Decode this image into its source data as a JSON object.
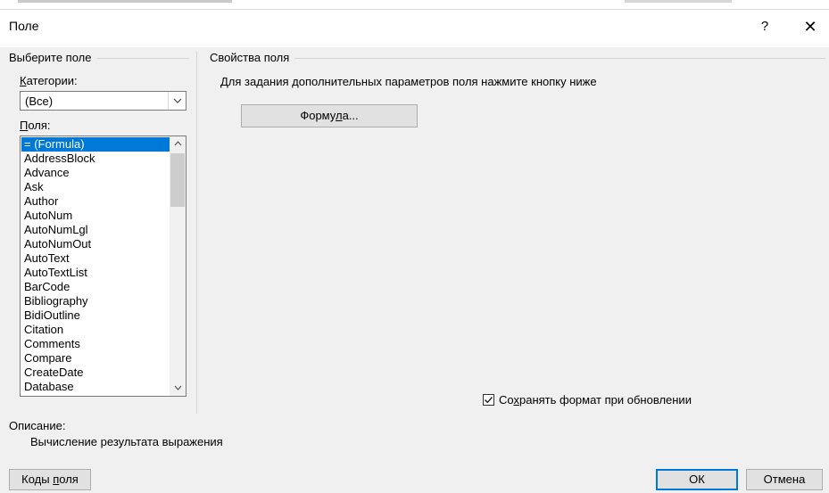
{
  "window": {
    "title": "Поле",
    "help_label": "?",
    "close_label": "✕"
  },
  "left_group": {
    "label": "Выберите поле",
    "categories": {
      "label_prefix": "К",
      "label_rest": "атегории:",
      "selected": "(Все)"
    },
    "fields": {
      "label_prefix": "П",
      "label_rest": "оля:",
      "items": [
        {
          "label": "= (Formula)",
          "selected": true
        },
        {
          "label": "AddressBlock"
        },
        {
          "label": "Advance"
        },
        {
          "label": "Ask"
        },
        {
          "label": "Author"
        },
        {
          "label": "AutoNum"
        },
        {
          "label": "AutoNumLgl"
        },
        {
          "label": "AutoNumOut"
        },
        {
          "label": "AutoText"
        },
        {
          "label": "AutoTextList"
        },
        {
          "label": "BarCode"
        },
        {
          "label": "Bibliography"
        },
        {
          "label": "BidiOutline"
        },
        {
          "label": "Citation"
        },
        {
          "label": "Comments"
        },
        {
          "label": "Compare"
        },
        {
          "label": "CreateDate"
        },
        {
          "label": "Database"
        }
      ]
    }
  },
  "right_group": {
    "label": "Свойства поля",
    "instruction": "Для задания дополнительных параметров поля нажмите кнопку ниже",
    "formula_button": {
      "pre": "Форму",
      "underlined": "л",
      "post": "а..."
    },
    "preserve_format": {
      "checked": true,
      "pre": "Со",
      "underlined": "х",
      "post": "ранять формат при обновлении"
    }
  },
  "description": {
    "label": "Описание:",
    "text": "Вычисление результата выражения"
  },
  "footer": {
    "field_codes_button": {
      "pre": "Коды ",
      "underlined": "п",
      "post": "оля"
    },
    "ok_label": "ОК",
    "cancel_label": "Отмена"
  },
  "colors": {
    "selection": "#0078d7",
    "dialog_bg": "#f0f0f0"
  }
}
